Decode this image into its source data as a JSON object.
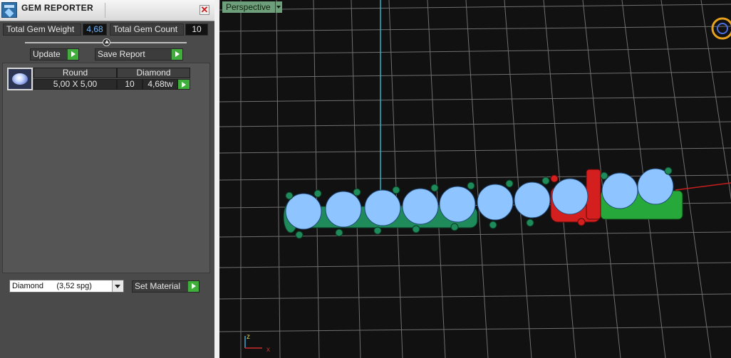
{
  "panel": {
    "title": "GEM REPORTER",
    "close_glyph": "✕",
    "total_weight_label": "Total Gem Weight",
    "total_weight_value": "4,68",
    "total_count_label": "Total Gem Count",
    "total_count_value": "10",
    "update_label": "Update",
    "save_report_label": "Save Report",
    "table": {
      "headers": [
        "Round",
        "Diamond"
      ],
      "size": "5,00 X 5,00",
      "count": "10",
      "weight": "4,68tw"
    },
    "material_select_value": "Diamond      (3,52 spg)",
    "set_material_label": "Set Material"
  },
  "viewport": {
    "view_label": "Perspective",
    "axis_x_label": "x",
    "axis_z_label": "z"
  },
  "colors": {
    "gem_prong_green": "#1f8a5a",
    "selected_red": "#d41f1f",
    "selected_green": "#27a83a",
    "gem_blue": "#8ec4ff",
    "grid": "#6f6f6f"
  }
}
